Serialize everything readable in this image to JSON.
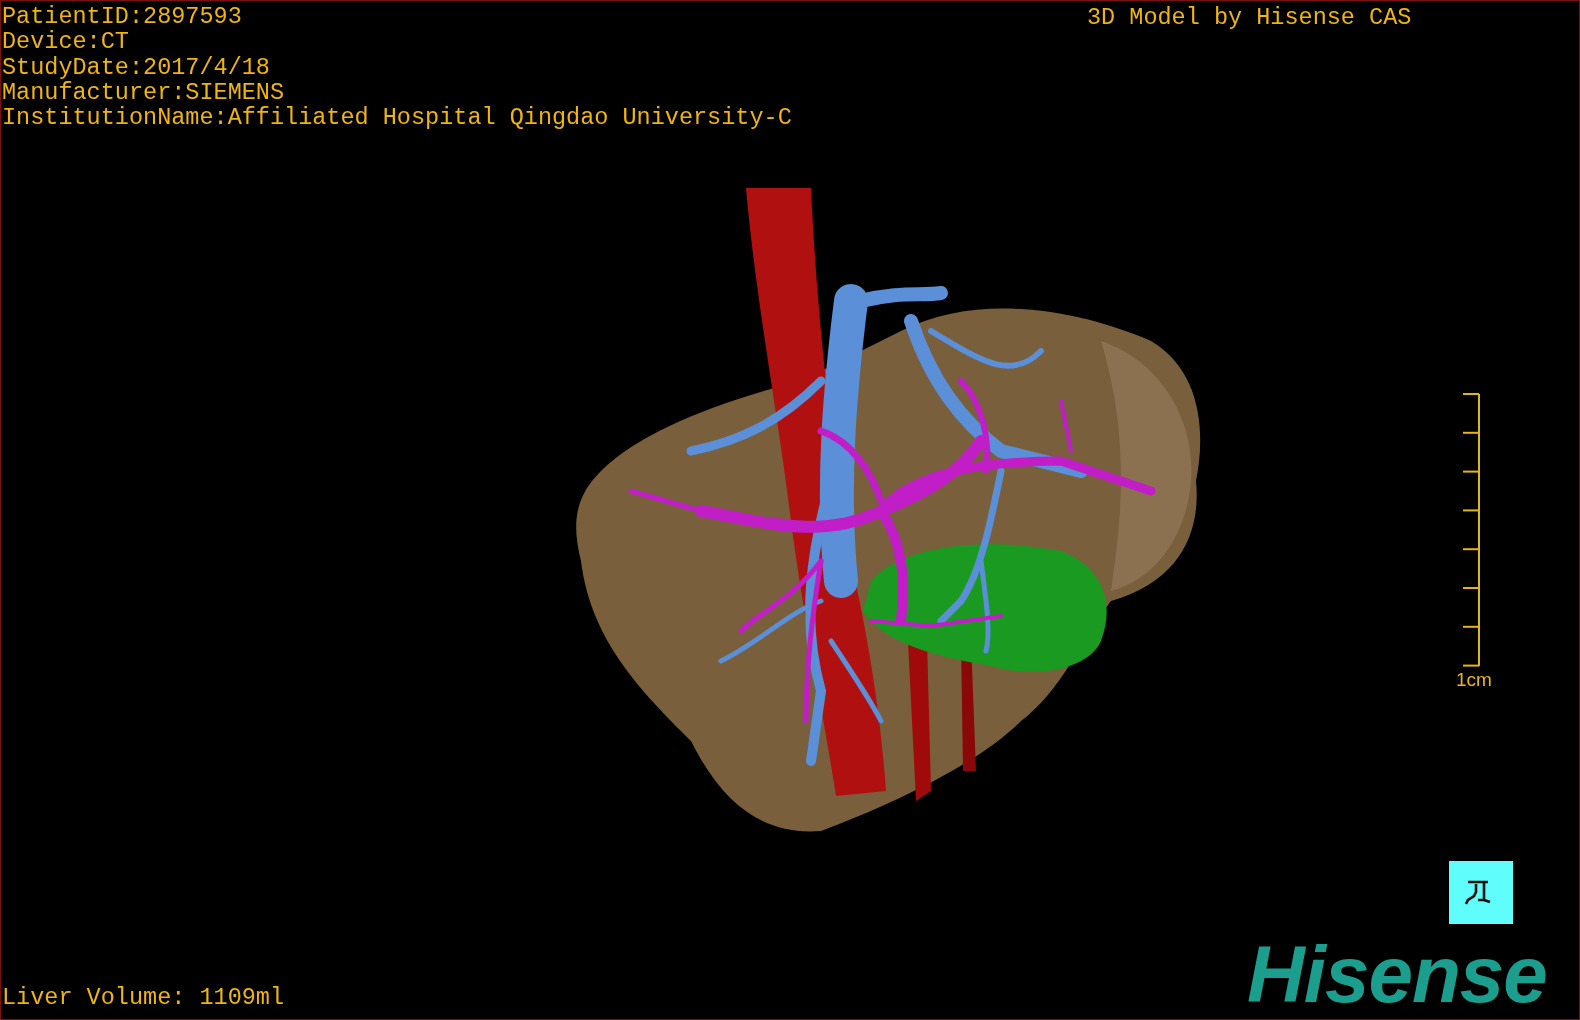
{
  "patient_info": [
    "PatientID:2897593",
    "Device:CT",
    "StudyDate:2017/4/18",
    "Manufacturer:SIEMENS",
    "InstitutionName:Affiliated Hospital Qingdao University-C"
  ],
  "header_credit": "3D Model by Hisense CAS",
  "scale_bar": {
    "label": "1cm"
  },
  "liver_volume": "Liver Volume: 1109ml",
  "logo": "Hisense"
}
